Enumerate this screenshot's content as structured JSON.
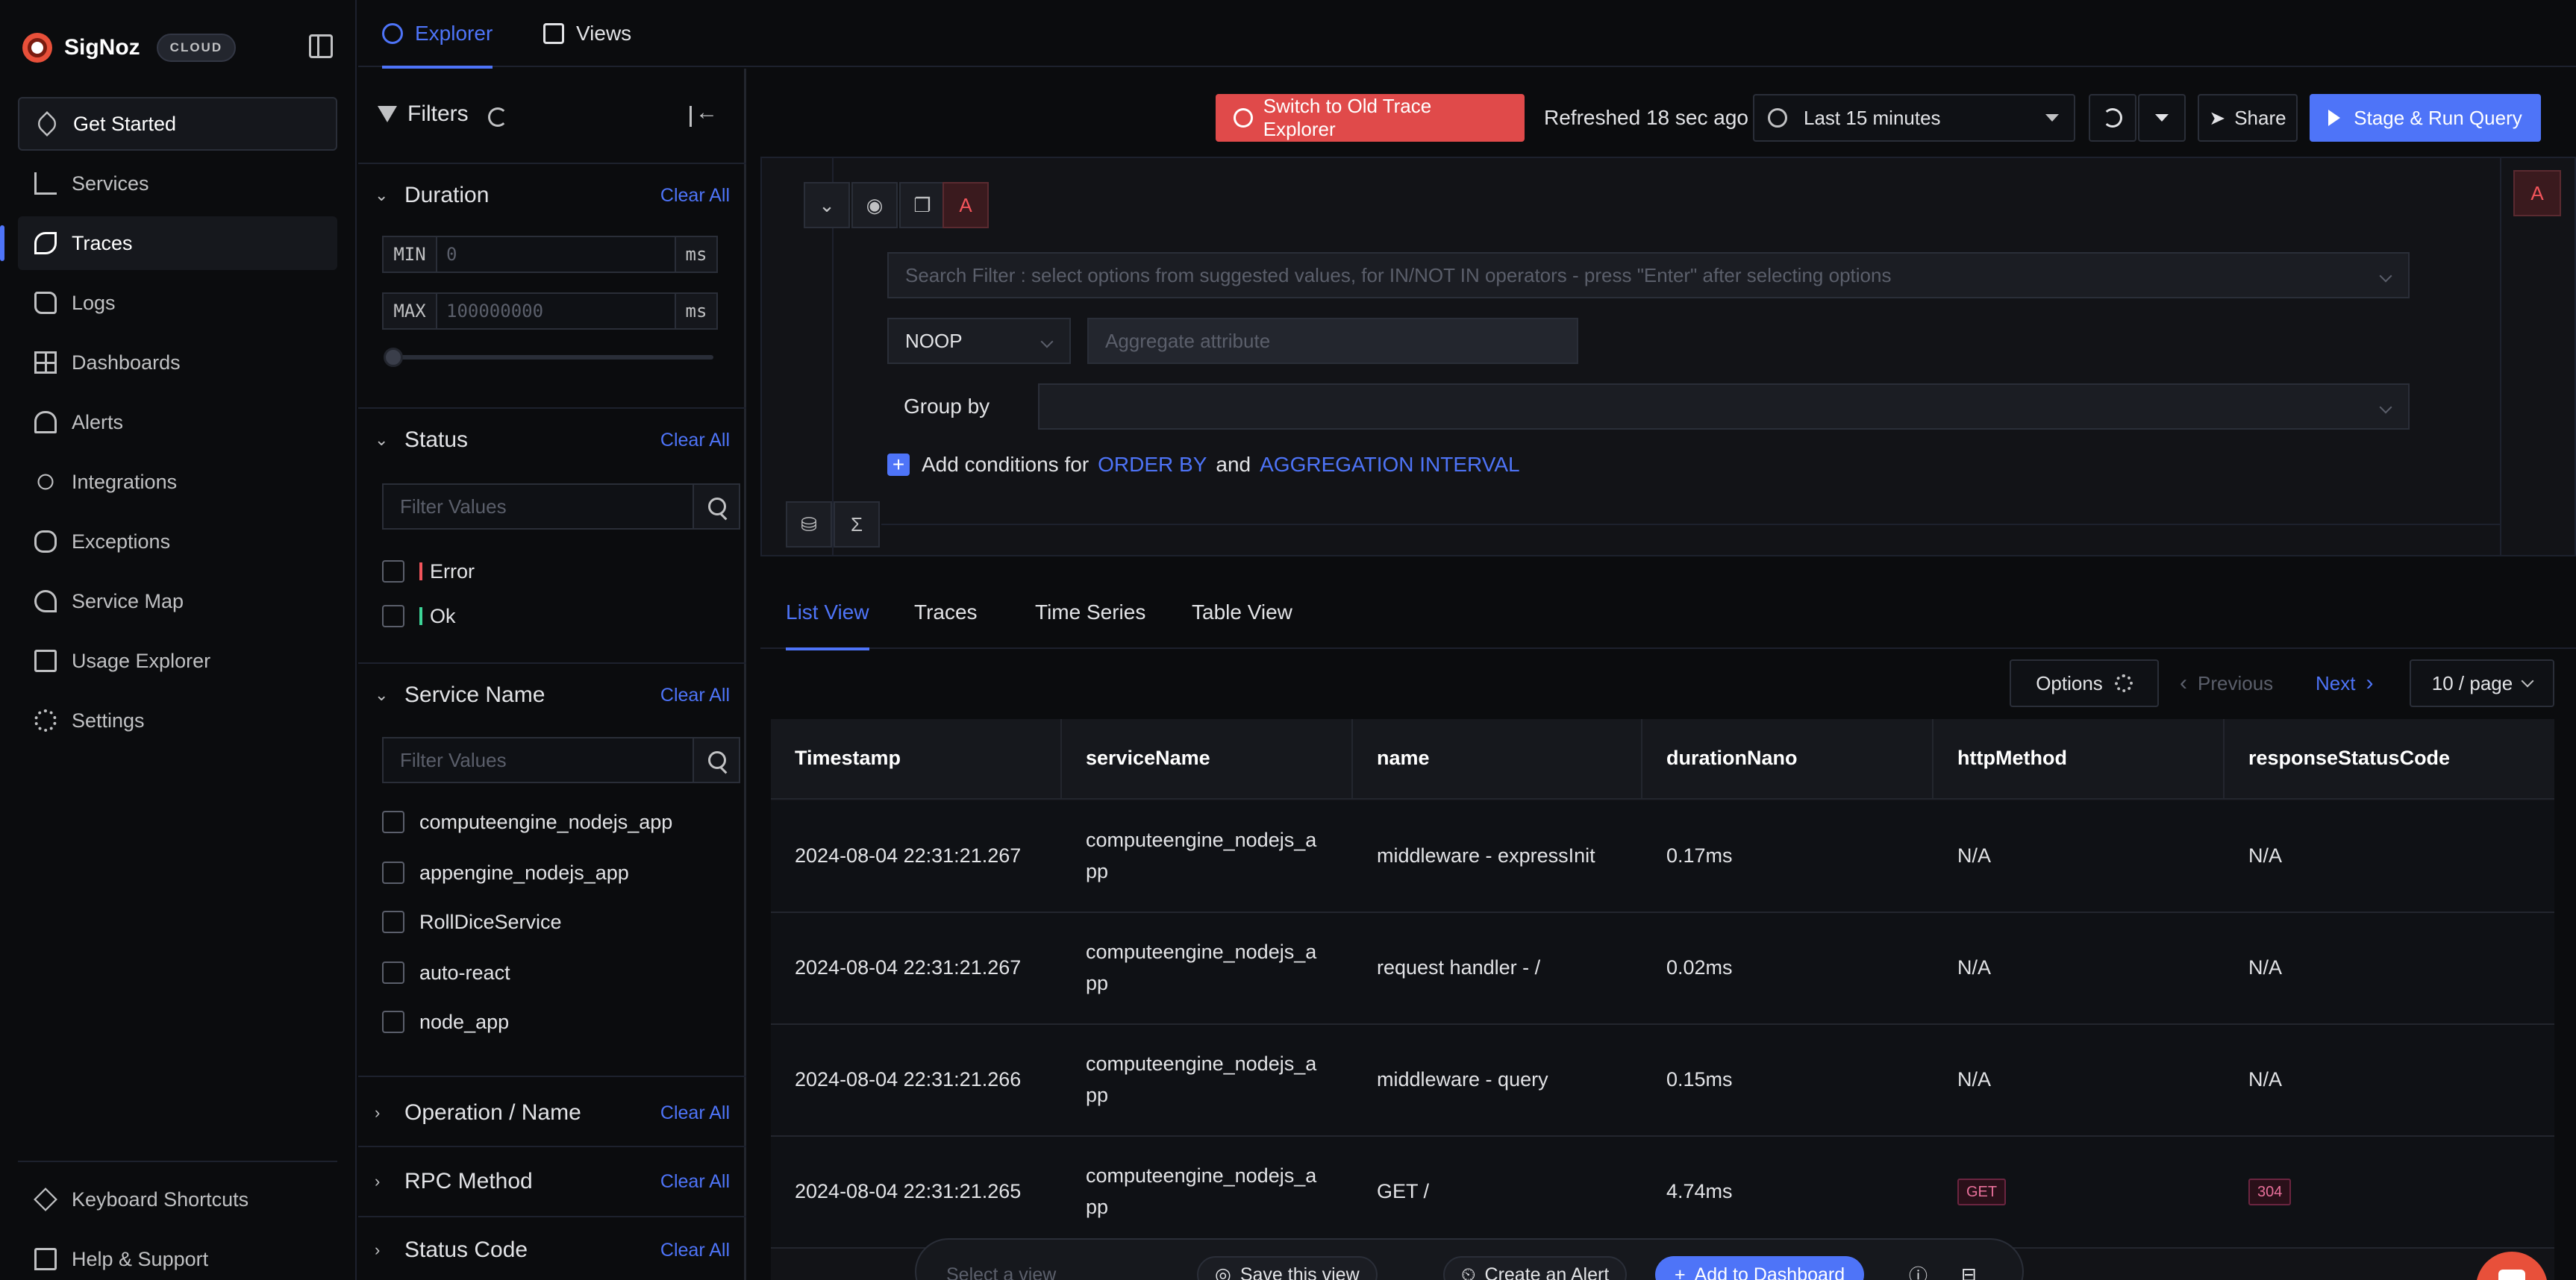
{
  "brand": {
    "name": "SigNoz",
    "badge": "CLOUD"
  },
  "sidebar": {
    "items": [
      {
        "label": "Get Started",
        "icon": "rocket-icon"
      },
      {
        "label": "Services",
        "icon": "bar-chart-icon"
      },
      {
        "label": "Traces",
        "icon": "route-icon"
      },
      {
        "label": "Logs",
        "icon": "scroll-icon"
      },
      {
        "label": "Dashboards",
        "icon": "layout-grid-icon"
      },
      {
        "label": "Alerts",
        "icon": "bell-icon"
      },
      {
        "label": "Integrations",
        "icon": "plug-icon"
      },
      {
        "label": "Exceptions",
        "icon": "bug-icon"
      },
      {
        "label": "Service Map",
        "icon": "route-map-icon"
      },
      {
        "label": "Usage Explorer",
        "icon": "line-chart-icon"
      },
      {
        "label": "Settings",
        "icon": "gear-icon"
      }
    ],
    "bottom": [
      {
        "label": "Keyboard Shortcuts",
        "icon": "layers-icon"
      },
      {
        "label": "Help & Support",
        "icon": "message-square-icon"
      }
    ],
    "active": "Traces"
  },
  "top_tabs": {
    "explorer": "Explorer",
    "views": "Views"
  },
  "filters": {
    "title": "Filters",
    "duration": {
      "title": "Duration",
      "clear": "Clear All",
      "min_label": "MIN",
      "min_placeholder": "0",
      "max_label": "MAX",
      "max_placeholder": "100000000",
      "unit": "ms"
    },
    "status": {
      "title": "Status",
      "clear": "Clear All",
      "placeholder": "Filter Values",
      "options": [
        "Error",
        "Ok"
      ]
    },
    "service_name": {
      "title": "Service Name",
      "clear": "Clear All",
      "placeholder": "Filter Values",
      "options": [
        "computeengine_nodejs_app",
        "appengine_nodejs_app",
        "RollDiceService",
        "auto-react",
        "node_app"
      ]
    },
    "operation": {
      "title": "Operation / Name",
      "clear": "Clear All"
    },
    "rpc": {
      "title": "RPC Method",
      "clear": "Clear All"
    },
    "status_code": {
      "title": "Status Code",
      "clear": "Clear All"
    }
  },
  "toolbar": {
    "switch_old": "Switch to Old Trace Explorer",
    "refreshed": "Refreshed 18 sec ago",
    "time_range": "Last 15 minutes",
    "share": "Share",
    "run": "Stage & Run Query"
  },
  "query": {
    "letter": "A",
    "search_placeholder": "Search Filter : select options from suggested values, for IN/NOT IN operators - press \"Enter\" after selecting options",
    "aggregate_op": "NOOP",
    "aggregate_placeholder": "Aggregate attribute",
    "group_by_label": "Group by",
    "add_conditions_prefix": "Add conditions for",
    "order_by": "ORDER BY",
    "and": "and",
    "aggregation_interval": "AGGREGATION INTERVAL",
    "sigma": "Σ"
  },
  "view_tabs": [
    "List View",
    "Traces",
    "Time Series",
    "Table View"
  ],
  "pager": {
    "options": "Options",
    "previous": "Previous",
    "next": "Next",
    "per_page": "10 / page"
  },
  "table": {
    "columns": [
      "Timestamp",
      "serviceName",
      "name",
      "durationNano",
      "httpMethod",
      "responseStatusCode"
    ],
    "rows": [
      {
        "timestamp": "2024-08-04 22:31:21.267",
        "service": "computeengine_nodejs_a pp",
        "name": "middleware - expressInit",
        "duration": "0.17ms",
        "method": "N/A",
        "status": "N/A"
      },
      {
        "timestamp": "2024-08-04 22:31:21.267",
        "service": "computeengine_nodejs_a pp",
        "name": "request handler - /",
        "duration": "0.02ms",
        "method": "N/A",
        "status": "N/A"
      },
      {
        "timestamp": "2024-08-04 22:31:21.266",
        "service": "computeengine_nodejs_a pp",
        "name": "middleware - query",
        "duration": "0.15ms",
        "method": "N/A",
        "status": "N/A"
      },
      {
        "timestamp": "2024-08-04 22:31:21.265",
        "service": "computeengine_nodejs_a pp",
        "name": "GET /",
        "duration": "4.74ms",
        "method": "GET",
        "status": "304"
      }
    ]
  },
  "footer_bar": {
    "select_view": "Select a view",
    "save_view": "Save this view",
    "create_alert": "Create an Alert",
    "add_dashboard": "Add to Dashboard"
  },
  "colors": {
    "accent": "#4e74f8",
    "danger": "#e04a4a",
    "background": "#0b0c0e"
  }
}
